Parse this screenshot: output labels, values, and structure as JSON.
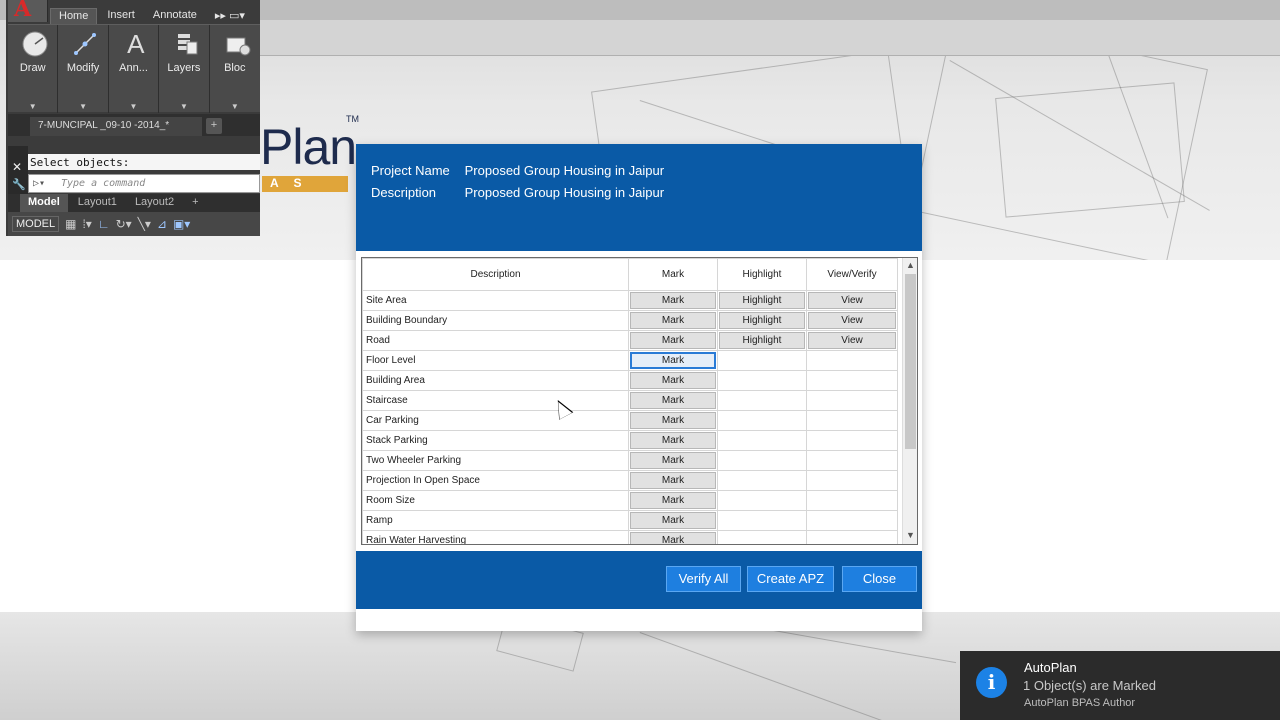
{
  "autocad": {
    "logo": "A",
    "tabs": [
      "Home",
      "Insert",
      "Annotate"
    ],
    "ribbon": [
      {
        "label": "Draw",
        "icon": "draw-icon"
      },
      {
        "label": "Modify",
        "icon": "modify-icon"
      },
      {
        "label": "Ann...",
        "icon": "annotate-icon"
      },
      {
        "label": "Layers",
        "icon": "layers-icon"
      },
      {
        "label": "Bloc",
        "icon": "block-icon"
      }
    ],
    "document_tab": "7-MUNCIPAL _09-10 -2014_*",
    "command_history": "Select objects:",
    "command_placeholder": "Type a command",
    "layout_tabs": [
      "Model",
      "Layout1",
      "Layout2"
    ],
    "status_model": "MODEL"
  },
  "logo": {
    "word": "Plan",
    "tm": "TM",
    "bar": "A S"
  },
  "dialog": {
    "project_name_label": "Project Name",
    "project_name_value": "Proposed Group Housing in Jaipur",
    "description_label": "Description",
    "description_value": "Proposed Group Housing in Jaipur",
    "columns": [
      "Description",
      "Mark",
      "Highlight",
      "View/Verify"
    ],
    "rows": [
      {
        "description": "Site Area",
        "mark": "Mark",
        "highlight": "Highlight",
        "view": "View"
      },
      {
        "description": "Building Boundary",
        "mark": "Mark",
        "highlight": "Highlight",
        "view": "View"
      },
      {
        "description": "Road",
        "mark": "Mark",
        "highlight": "Highlight",
        "view": "View"
      },
      {
        "description": "Floor Level",
        "mark": "Mark",
        "highlight": "",
        "view": ""
      },
      {
        "description": "Building Area",
        "mark": "Mark",
        "highlight": "",
        "view": ""
      },
      {
        "description": "Staircase",
        "mark": "Mark",
        "highlight": "",
        "view": ""
      },
      {
        "description": "Car Parking",
        "mark": "Mark",
        "highlight": "",
        "view": ""
      },
      {
        "description": "Stack Parking",
        "mark": "Mark",
        "highlight": "",
        "view": ""
      },
      {
        "description": "Two Wheeler Parking",
        "mark": "Mark",
        "highlight": "",
        "view": ""
      },
      {
        "description": "Projection In Open Space",
        "mark": "Mark",
        "highlight": "",
        "view": ""
      },
      {
        "description": "Room Size",
        "mark": "Mark",
        "highlight": "",
        "view": ""
      },
      {
        "description": "Ramp",
        "mark": "Mark",
        "highlight": "",
        "view": ""
      },
      {
        "description": "Rain Water Harvesting",
        "mark": "Mark",
        "highlight": "",
        "view": ""
      }
    ],
    "focused_row": 3,
    "buttons": {
      "verify_all": "Verify All",
      "create_apz": "Create APZ",
      "close": "Close"
    }
  },
  "toast": {
    "title": "AutoPlan",
    "message": "1 Object(s) are Marked",
    "source": "AutoPlan BPAS Author",
    "icon": "info-icon",
    "icon_glyph": "i"
  },
  "colors": {
    "dialog_blue": "#0a5aa6",
    "button_blue": "#1e7fe0",
    "toast_bg": "#2b2b2b",
    "info_blue": "#1c82e6"
  }
}
